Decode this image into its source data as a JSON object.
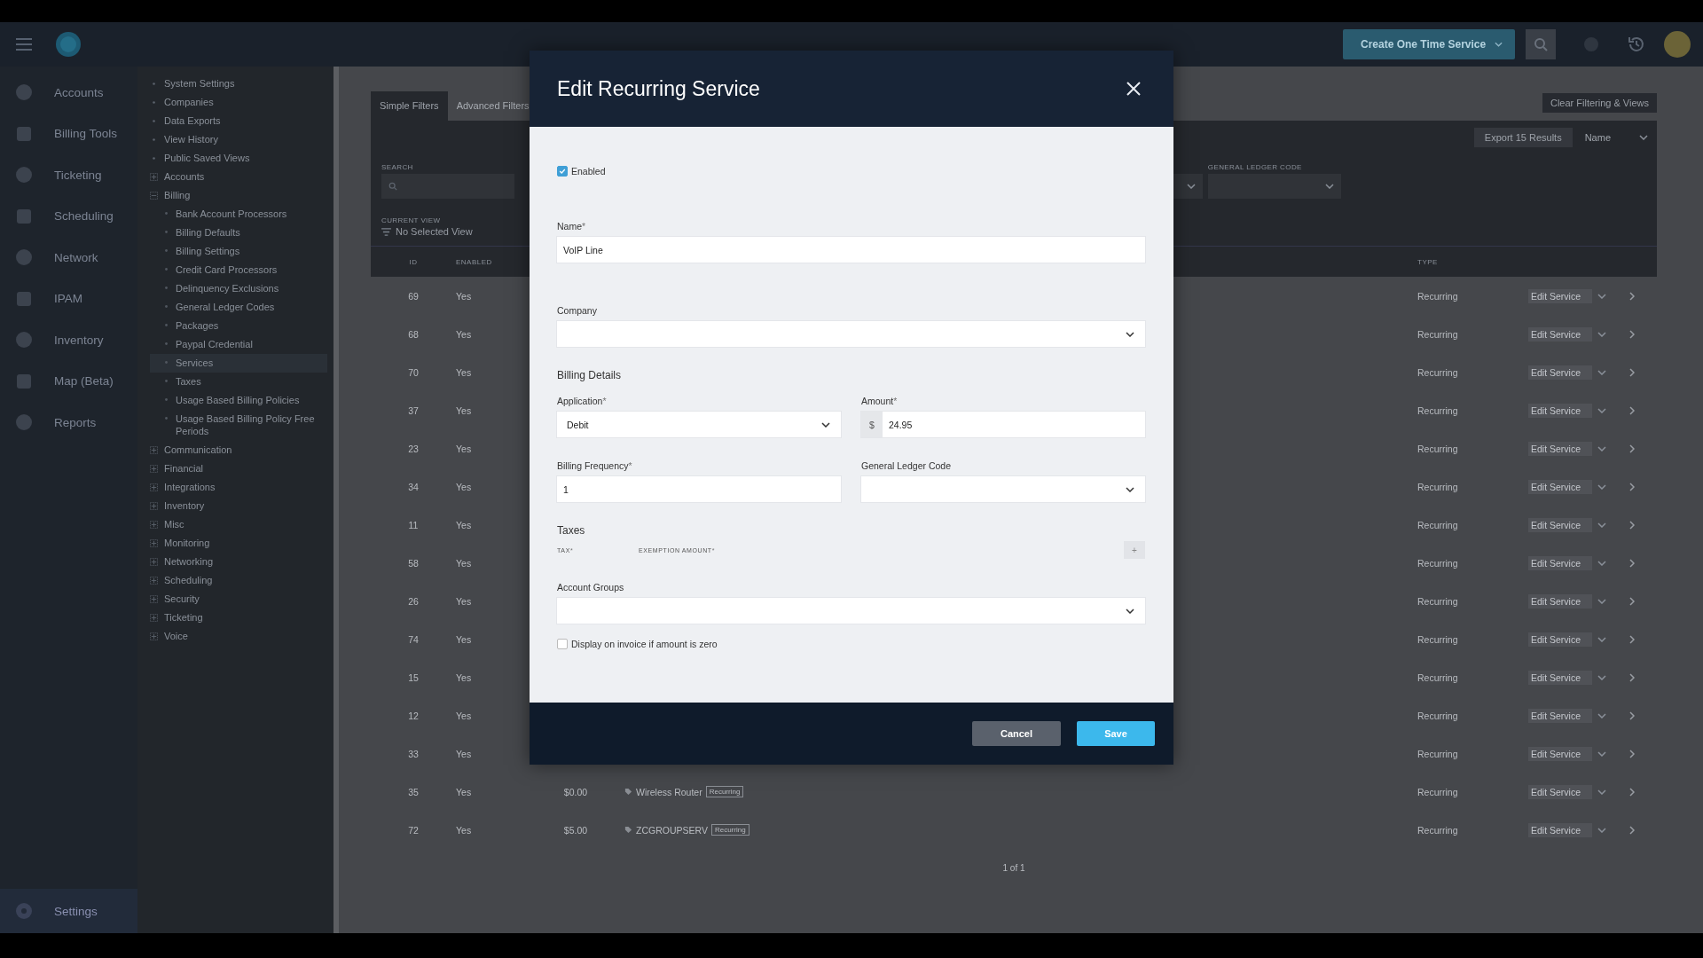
{
  "top_bar": {
    "create_button": "Create One Time Service"
  },
  "nav": [
    {
      "label": "Accounts",
      "selected": false
    },
    {
      "label": "Billing Tools",
      "selected": false
    },
    {
      "label": "Ticketing",
      "selected": false
    },
    {
      "label": "Scheduling",
      "selected": false
    },
    {
      "label": "Network",
      "selected": false
    },
    {
      "label": "IPAM",
      "selected": false
    },
    {
      "label": "Inventory",
      "selected": false
    },
    {
      "label": "Map (Beta)",
      "selected": false
    },
    {
      "label": "Reports",
      "selected": false
    }
  ],
  "nav_footer": {
    "label": "Settings",
    "selected": true
  },
  "settings_tree": [
    {
      "label": "System Settings",
      "kind": "link"
    },
    {
      "label": "Companies",
      "kind": "link"
    },
    {
      "label": "Data Exports",
      "kind": "link"
    },
    {
      "label": "View History",
      "kind": "link"
    },
    {
      "label": "Public Saved Views",
      "kind": "link"
    },
    {
      "label": "Accounts",
      "kind": "group",
      "expanded": false
    },
    {
      "label": "Billing",
      "kind": "group",
      "expanded": true,
      "children": [
        {
          "label": "Bank Account Processors",
          "selected": false
        },
        {
          "label": "Billing Defaults",
          "selected": false
        },
        {
          "label": "Billing Settings",
          "selected": false
        },
        {
          "label": "Credit Card Processors",
          "selected": false
        },
        {
          "label": "Delinquency Exclusions",
          "selected": false
        },
        {
          "label": "General Ledger Codes",
          "selected": false
        },
        {
          "label": "Packages",
          "selected": false
        },
        {
          "label": "Paypal Credential",
          "selected": false
        },
        {
          "label": "Services",
          "selected": true
        },
        {
          "label": "Taxes",
          "selected": false
        },
        {
          "label": "Usage Based Billing Policies",
          "selected": false
        },
        {
          "label": "Usage Based Billing Policy Free Periods",
          "selected": false
        }
      ]
    },
    {
      "label": "Communication",
      "kind": "group",
      "expanded": false
    },
    {
      "label": "Financial",
      "kind": "group",
      "expanded": false
    },
    {
      "label": "Integrations",
      "kind": "group",
      "expanded": false
    },
    {
      "label": "Inventory",
      "kind": "group",
      "expanded": false
    },
    {
      "label": "Misc",
      "kind": "group",
      "expanded": false
    },
    {
      "label": "Monitoring",
      "kind": "group",
      "expanded": false
    },
    {
      "label": "Networking",
      "kind": "group",
      "expanded": false
    },
    {
      "label": "Scheduling",
      "kind": "group",
      "expanded": false
    },
    {
      "label": "Security",
      "kind": "group",
      "expanded": false
    },
    {
      "label": "Ticketing",
      "kind": "group",
      "expanded": false
    },
    {
      "label": "Voice",
      "kind": "group",
      "expanded": false
    }
  ],
  "filters": {
    "tabs": [
      {
        "label": "Simple Filters",
        "selected": true
      },
      {
        "label": "Advanced Filters",
        "selected": false
      }
    ],
    "clear_button": "Clear Filtering & Views",
    "search_label": "SEARCH",
    "gl_code_label": "GENERAL LEDGER CODE",
    "export_button": "Export 15 Results",
    "sort_label": "Name",
    "current_view_label": "CURRENT VIEW",
    "current_view": "No Selected View"
  },
  "table": {
    "columns": [
      "ID",
      "ENABLED",
      "TYPE"
    ],
    "rows": [
      {
        "id": "69",
        "enabled": "Yes",
        "type": "Recurring",
        "action": "Edit Service"
      },
      {
        "id": "68",
        "enabled": "Yes",
        "type": "Recurring",
        "action": "Edit Service"
      },
      {
        "id": "70",
        "enabled": "Yes",
        "type": "Recurring",
        "action": "Edit Service"
      },
      {
        "id": "37",
        "enabled": "Yes",
        "type": "Recurring",
        "action": "Edit Service"
      },
      {
        "id": "23",
        "enabled": "Yes",
        "type": "Recurring",
        "action": "Edit Service"
      },
      {
        "id": "34",
        "enabled": "Yes",
        "type": "Recurring",
        "action": "Edit Service"
      },
      {
        "id": "11",
        "enabled": "Yes",
        "type": "Recurring",
        "action": "Edit Service"
      },
      {
        "id": "58",
        "enabled": "Yes",
        "type": "Recurring",
        "action": "Edit Service"
      },
      {
        "id": "26",
        "enabled": "Yes",
        "type": "Recurring",
        "action": "Edit Service"
      },
      {
        "id": "74",
        "enabled": "Yes",
        "type": "Recurring",
        "action": "Edit Service"
      },
      {
        "id": "15",
        "enabled": "Yes",
        "type": "Recurring",
        "action": "Edit Service"
      },
      {
        "id": "12",
        "enabled": "Yes",
        "type": "Recurring",
        "action": "Edit Service"
      },
      {
        "id": "33",
        "enabled": "Yes",
        "type": "Recurring",
        "action": "Edit Service"
      },
      {
        "id": "35",
        "enabled": "Yes",
        "price": "$0.00",
        "name": "Wireless Router",
        "badge": "Recurring",
        "type": "Recurring",
        "action": "Edit Service"
      },
      {
        "id": "72",
        "enabled": "Yes",
        "price": "$5.00",
        "name": "ZCGROUPSERV",
        "badge": "Recurring",
        "type": "Recurring",
        "action": "Edit Service"
      }
    ],
    "pagination": "1 of 1"
  },
  "modal": {
    "title": "Edit Recurring Service",
    "enabled": {
      "label": "Enabled",
      "checked": true
    },
    "name": {
      "label": "Name",
      "mark": "*",
      "value": "VoIP Line"
    },
    "company": {
      "label": "Company"
    },
    "billing_heading": "Billing Details",
    "application": {
      "label": "Application",
      "mark": "*",
      "value": "Debit"
    },
    "amount": {
      "label": "Amount",
      "mark": "*",
      "prefix": "$",
      "value": "24.95"
    },
    "billing_frequency": {
      "label": "Billing Frequency",
      "mark": "*",
      "value": "1"
    },
    "gl_code": {
      "label": "General Ledger Code"
    },
    "taxes": {
      "heading": "Taxes",
      "columns": [
        {
          "label": "TAX",
          "mark": "*"
        },
        {
          "label": "EXEMPTION AMOUNT",
          "mark": "*"
        }
      ],
      "add_button": "+"
    },
    "account_groups": {
      "label": "Account Groups"
    },
    "display_zero": {
      "label": "Display on invoice if amount is zero",
      "checked": false
    },
    "buttons": [
      {
        "label": "Cancel",
        "kind": "secondary"
      },
      {
        "label": "Save",
        "kind": "primary"
      }
    ]
  }
}
